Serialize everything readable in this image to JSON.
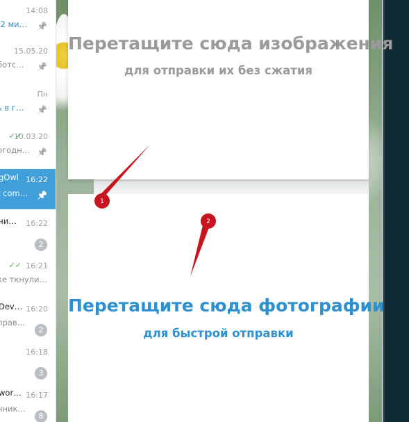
{
  "chat_list": [
    {
      "title": "",
      "preview": "(2 ми…",
      "time": "14:08",
      "pinned": true,
      "preview_link": true
    },
    {
      "title": "",
      "preview": "ботс…",
      "time": "15.05.20",
      "pinned": true
    },
    {
      "title": "",
      "preview": "ь в г…",
      "time": "Пн",
      "pinned": true,
      "preview_link": true
    },
    {
      "title": "",
      "preview": "огодн…",
      "time": "10.03.20",
      "pinned": true,
      "read": true
    },
    {
      "title": "gOwl",
      "preview": "t com…",
      "time": "16:22",
      "pinned": true,
      "active": true
    },
    {
      "title": "чи…",
      "preview": "",
      "time": "16:22",
      "badge": "2"
    },
    {
      "title": "",
      "preview": "ке ткнули…",
      "time": "16:21",
      "read": true
    },
    {
      "title": "Dev…",
      "preview": "прав…",
      "time": "16:20",
      "badge": "2"
    },
    {
      "title": "",
      "preview": "",
      "time": "16:18",
      "badge": "3"
    },
    {
      "title": "wor…",
      "preview": "нник…",
      "time": "16:17",
      "badge": "8"
    }
  ],
  "drop_zone_files": {
    "title": "Перетащите сюда изображения",
    "subtitle": "для отправки их без сжатия"
  },
  "drop_zone_photos": {
    "title": "Перетащите сюда фотографии",
    "subtitle": "для быстрой отправки"
  },
  "annotations": [
    {
      "label": "1"
    },
    {
      "label": "2"
    }
  ],
  "colors": {
    "accent": "#2e90cf",
    "active_chat": "#419fd9",
    "muted_text": "#9a9a9a",
    "marker": "#c8141e"
  }
}
